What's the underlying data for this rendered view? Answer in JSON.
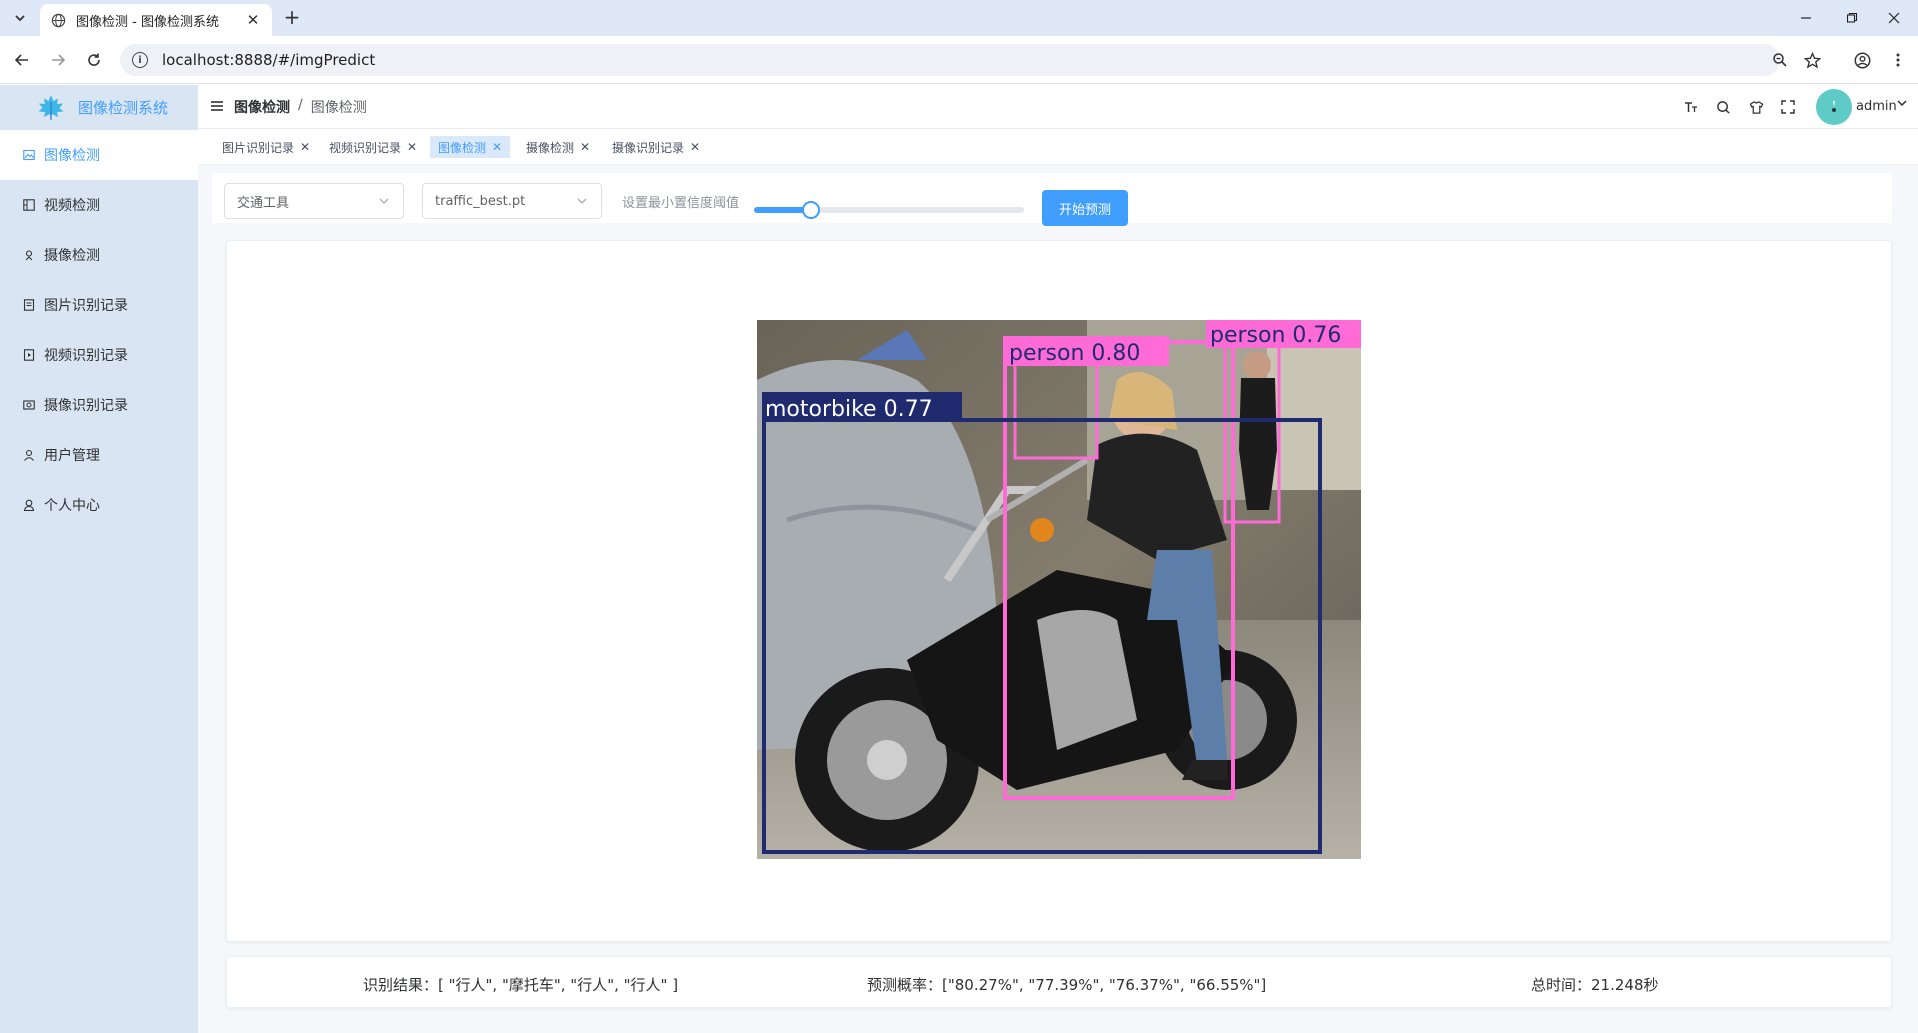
{
  "browser": {
    "tab_title": "图像检测 - 图像检测系统",
    "url": "localhost:8888/#/imgPredict"
  },
  "app": {
    "logo_name": "图像检测系统",
    "accent": "#409eff",
    "sidebar_bg": "#d9e5f3"
  },
  "sidebar": {
    "items": [
      {
        "label": "图像检测",
        "icon": "image-icon"
      },
      {
        "label": "视频检测",
        "icon": "video-icon"
      },
      {
        "label": "摄像检测",
        "icon": "camera-icon"
      },
      {
        "label": "图片识别记录",
        "icon": "record-icon"
      },
      {
        "label": "视频识别记录",
        "icon": "video-record-icon"
      },
      {
        "label": "摄像识别记录",
        "icon": "camera-record-icon"
      },
      {
        "label": "用户管理",
        "icon": "user-icon"
      },
      {
        "label": "个人中心",
        "icon": "profile-icon"
      }
    ]
  },
  "header": {
    "breadcrumb_root": "图像检测",
    "breadcrumb_sep": "/",
    "breadcrumb_current": "图像检测",
    "user_name": "admin"
  },
  "tags": [
    "图片识别记录",
    "视频识别记录",
    "图像检测",
    "摄像检测",
    "摄像识别记录"
  ],
  "toolbar": {
    "category_value": "交通工具",
    "model_value": "traffic_best.pt",
    "slider_label": "设置最小置信度阈值",
    "slider_value": 0.21,
    "predict_label": "开始预测"
  },
  "detections": [
    {
      "label": "person  0.80",
      "color": "#ff6bd6"
    },
    {
      "label": "person  0.76",
      "color": "#ff6bd6"
    },
    {
      "label": "motorbike  0.77",
      "color": "#1f2b6e"
    }
  ],
  "results": {
    "recognition": "识别结果：[ \"行人\", \"摩托车\", \"行人\", \"行人\" ]",
    "probability": "预测概率：[\"80.27%\", \"77.39%\", \"76.37%\", \"66.55%\"]",
    "total_time": "总时间：21.248秒"
  }
}
